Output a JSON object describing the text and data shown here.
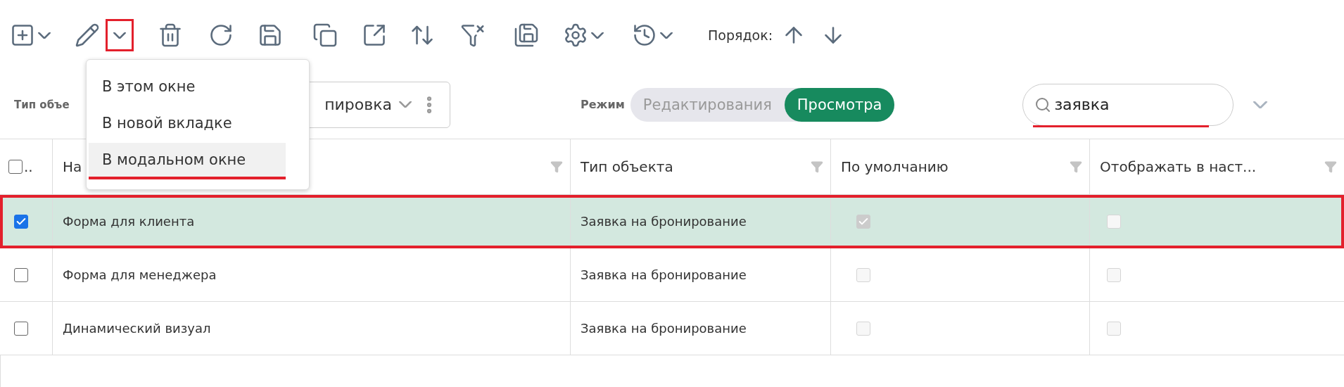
{
  "toolbar": {
    "edit_dropdown": {
      "expanded": true,
      "highlighted": true
    },
    "order_label": "Порядок:"
  },
  "edit_menu": {
    "items": [
      {
        "label": "В этом окне",
        "selected": false,
        "highlighted": false
      },
      {
        "label": "В новой вкладке",
        "selected": false,
        "highlighted": false
      },
      {
        "label": "В модальном окне",
        "selected": true,
        "highlighted": true
      }
    ]
  },
  "filters": {
    "object_type_label": "Тип объе",
    "object_type_value": "пировка",
    "mode_label": "Режим",
    "modes": [
      {
        "label": "Редактирования",
        "selected": false
      },
      {
        "label": "Просмотра",
        "selected": true
      }
    ],
    "search": {
      "value": "заявка",
      "highlighted": true
    }
  },
  "table": {
    "select_all": {
      "checked": false,
      "label": ".."
    },
    "columns": [
      {
        "label": "На"
      },
      {
        "label": "Тип объекта"
      },
      {
        "label": "По умолчанию"
      },
      {
        "label": "Отображать в наст..."
      }
    ],
    "rows": [
      {
        "selected": true,
        "highlighted": true,
        "name": "Форма для клиента",
        "object_type": "Заявка на бронирование",
        "default": {
          "checked": true,
          "disabled": true
        },
        "display": {
          "checked": false,
          "disabled": true
        }
      },
      {
        "selected": false,
        "highlighted": false,
        "name": "Форма для менеджера",
        "object_type": "Заявка на бронирование",
        "default": {
          "checked": false,
          "disabled": true
        },
        "display": {
          "checked": false,
          "disabled": true
        }
      },
      {
        "selected": false,
        "highlighted": false,
        "name": "Динамический визуал",
        "object_type": "Заявка на бронирование",
        "default": {
          "checked": false,
          "disabled": true
        },
        "display": {
          "checked": false,
          "disabled": true
        }
      }
    ]
  }
}
